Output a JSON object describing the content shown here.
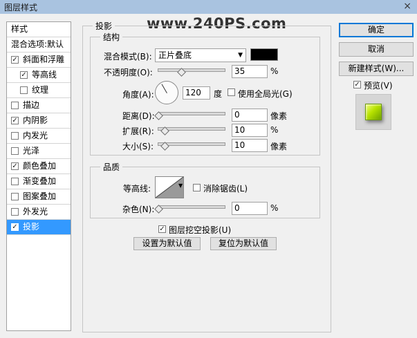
{
  "window": {
    "title": "图层样式",
    "close_glyph": "×"
  },
  "watermark": "www.240PS.com",
  "left_panel": {
    "header_styles": "样式",
    "header_blend": "混合选项:默认",
    "items": [
      {
        "label": "斜面和浮雕",
        "checked": true,
        "check_glyph": "✓",
        "indent": false
      },
      {
        "label": "等高线",
        "checked": true,
        "check_glyph": "✓",
        "indent": true
      },
      {
        "label": "纹理",
        "checked": false,
        "check_glyph": "",
        "indent": true
      },
      {
        "label": "描边",
        "checked": false,
        "check_glyph": ""
      },
      {
        "label": "内阴影",
        "checked": true,
        "check_glyph": "✓"
      },
      {
        "label": "内发光",
        "checked": false,
        "check_glyph": ""
      },
      {
        "label": "光泽",
        "checked": false,
        "check_glyph": ""
      },
      {
        "label": "颜色叠加",
        "checked": true,
        "check_glyph": "✓"
      },
      {
        "label": "渐变叠加",
        "checked": false,
        "check_glyph": ""
      },
      {
        "label": "图案叠加",
        "checked": false,
        "check_glyph": ""
      },
      {
        "label": "外发光",
        "checked": false,
        "check_glyph": ""
      },
      {
        "label": "投影",
        "checked": true,
        "check_glyph": "✓",
        "selected": true
      }
    ]
  },
  "shadow": {
    "title": "投影",
    "structure": {
      "title": "结构",
      "blend_mode_label": "混合模式(B):",
      "blend_mode_value": "正片叠底",
      "blend_color": "#000000",
      "opacity_label": "不透明度(O):",
      "opacity_value": "35",
      "opacity_unit": "%",
      "opacity_level": 0.35,
      "angle_label": "角度(A):",
      "angle_value": "120",
      "angle_unit": "度",
      "global_light_label": "使用全局光(G)",
      "global_light_checked": false,
      "distance_label": "距离(D):",
      "distance_value": "0",
      "distance_unit": "像素",
      "spread_label": "扩展(R):",
      "spread_value": "10",
      "spread_unit": "%",
      "size_label": "大小(S):",
      "size_value": "10",
      "size_unit": "像素"
    },
    "quality": {
      "title": "品质",
      "contour_label": "等高线:",
      "antialias_label": "消除锯齿(L)",
      "antialias_checked": false,
      "noise_label": "杂色(N):",
      "noise_value": "0",
      "noise_unit": "%"
    },
    "knockout_label": "图层挖空投影(U)",
    "knockout_check": "✓",
    "set_default_label": "设置为默认值",
    "reset_default_label": "复位为默认值"
  },
  "right": {
    "ok_label": "确定",
    "cancel_label": "取消",
    "new_style_label": "新建样式(W)...",
    "preview_label": "预览(V)",
    "preview_check": "✓"
  }
}
